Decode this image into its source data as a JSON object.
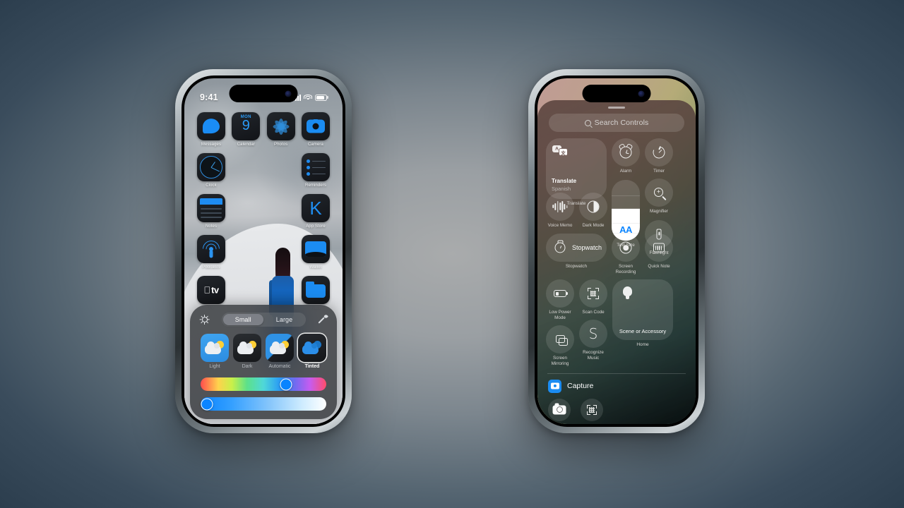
{
  "background": {
    "center_color": "#a9abac",
    "edge_color": "#2a3c4c"
  },
  "left_phone": {
    "status_bar": {
      "time": "9:41",
      "signal_icon": "cellular-signal-icon",
      "wifi_icon": "wifi-icon",
      "battery_icon": "battery-icon"
    },
    "apps": [
      [
        {
          "label": "Messages",
          "icon": "messages-icon"
        },
        {
          "label": "Calendar",
          "icon": "calendar-icon",
          "weekday": "MON",
          "day": "9"
        },
        {
          "label": "Photos",
          "icon": "photos-icon"
        },
        {
          "label": "Camera",
          "icon": "camera-icon"
        }
      ],
      [
        {
          "label": "Clock",
          "icon": "clock-icon"
        },
        {
          "label": "",
          "icon": ""
        },
        {
          "label": "",
          "icon": ""
        },
        {
          "label": "Reminders",
          "icon": "reminders-icon"
        }
      ],
      [
        {
          "label": "Notes",
          "icon": "notes-icon"
        },
        {
          "label": "",
          "icon": ""
        },
        {
          "label": "",
          "icon": ""
        },
        {
          "label": "App Store",
          "icon": "app-store-icon"
        }
      ],
      [
        {
          "label": "Podcasts",
          "icon": "podcasts-icon"
        },
        {
          "label": "",
          "icon": ""
        },
        {
          "label": "",
          "icon": ""
        },
        {
          "label": "Wallet",
          "icon": "wallet-icon"
        }
      ],
      [
        {
          "label": "TV",
          "icon": "tv-icon"
        },
        {
          "label": "",
          "icon": ""
        },
        {
          "label": "",
          "icon": ""
        },
        {
          "label": "Files",
          "icon": "files-icon"
        }
      ]
    ],
    "appearance_panel": {
      "brightness_icon": "sun-icon",
      "eyedropper_icon": "eyedropper-icon",
      "size_segments": [
        {
          "label": "Small",
          "selected": true
        },
        {
          "label": "Large",
          "selected": false
        }
      ],
      "themes": [
        {
          "label": "Light",
          "selected": false
        },
        {
          "label": "Dark",
          "selected": false
        },
        {
          "label": "Automatic",
          "selected": false
        },
        {
          "label": "Tinted",
          "selected": true
        }
      ],
      "hue_slider": {
        "name": "hue-slider",
        "value_percent": 68,
        "accent": "#0a84ff"
      },
      "brightness_slider": {
        "name": "tint-brightness-slider",
        "value_percent": 5,
        "accent": "#0a84ff"
      }
    }
  },
  "right_phone": {
    "grabber": "drag-handle",
    "search": {
      "placeholder": "Search Controls",
      "icon": "search-icon"
    },
    "controls": {
      "translate": {
        "title": "Translate",
        "subtitle": "Spanish",
        "caption": "Translate",
        "icon": "translate-icon"
      },
      "alarm": {
        "label": "Alarm",
        "icon": "alarm-clock-icon"
      },
      "timer": {
        "label": "Timer",
        "icon": "timer-icon"
      },
      "magnifier": {
        "label": "Magnifier",
        "icon": "magnifier-icon"
      },
      "voice_memo": {
        "label": "Voice Memo",
        "icon": "waveform-icon"
      },
      "dark_mode": {
        "label": "Dark Mode",
        "icon": "dark-mode-icon"
      },
      "text_size": {
        "label": "Text Size",
        "glyph": "AA",
        "icon": "text-size-icon",
        "fill_percent": 52
      },
      "flashlight": {
        "label": "Flashlight",
        "icon": "flashlight-icon"
      },
      "stopwatch": {
        "title": "Stopwatch",
        "caption": "Stopwatch",
        "icon": "stopwatch-icon"
      },
      "screen_recording": {
        "label": "Screen Recording",
        "icon": "record-icon"
      },
      "quick_note": {
        "label": "Quick Note",
        "icon": "quick-note-icon"
      },
      "low_power_mode": {
        "label": "Low Power Mode",
        "icon": "battery-low-icon"
      },
      "scan_code": {
        "label": "Scan Code",
        "icon": "qr-scan-icon"
      },
      "screen_mirroring": {
        "label": "Screen Mirroring",
        "icon": "screen-mirroring-icon"
      },
      "recognize_music": {
        "label": "Recognize Music",
        "icon": "shazam-icon"
      },
      "scene": {
        "title": "Scene or Accessory",
        "caption": "Home",
        "icon": "lightbulb-icon"
      }
    },
    "capture_section": {
      "label": "Capture",
      "icon": "camera-badge-icon"
    },
    "partial_controls": [
      {
        "name": "camera-control",
        "icon": "camera-icon"
      },
      {
        "name": "code-scanner-control",
        "icon": "qr-scan-icon"
      }
    ]
  }
}
